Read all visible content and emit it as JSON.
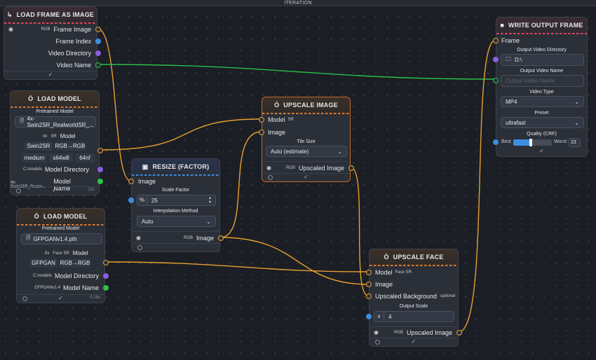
{
  "topbar": {
    "title": "ITERATION"
  },
  "nodes": {
    "load_frame": {
      "title": "LOAD FRAME AS IMAGE",
      "output_frame_image": "Frame Image",
      "output_frame_image_tag": "RGB",
      "output_frame_index": "Frame Index",
      "output_video_directory": "Video Directory",
      "output_video_name": "Video Name"
    },
    "load_model_1": {
      "title": "LOAD MODEL",
      "pretrained_label": "Pretrained Model",
      "pretrained_value": "4x-Swin2SR_RealworldSR_...",
      "scale_tag": "4x",
      "arch_tag": "SR",
      "model_label": "Model",
      "pill_arch": "Swin2SR",
      "pill_color": "RGB→RGB",
      "pill_size": "medium",
      "pill_config": "s64w8",
      "pill_nf": "64nf",
      "dir_tag": "C:\\models",
      "dir_label": "Model Directory",
      "name_tag": "4x-Swin2SR_Realw...",
      "name_label": "Model Name",
      "timer": "12s"
    },
    "load_model_2": {
      "title": "LOAD MODEL",
      "pretrained_label": "Pretrained Model",
      "pretrained_value": "GFPGANv1.4.pth",
      "scale_tag": "8x",
      "arch_tag": "Face SR",
      "model_label": "Model",
      "pill_arch": "GFPGAN",
      "pill_color": "RGB→RGB",
      "dir_tag": "C:\\models",
      "dir_label": "Model Directory",
      "name_tag": "GFPGANv1.4",
      "name_label": "Model Name",
      "timer": "0.18s"
    },
    "resize": {
      "title": "RESIZE (FACTOR)",
      "input_image": "Image",
      "scale_label": "Scale Factor",
      "scale_unit": "%",
      "scale_value": "25",
      "interp_label": "Interpolation Method",
      "interp_value": "Auto",
      "output_tag": "RGB",
      "output_image": "Image"
    },
    "upscale_image": {
      "title": "UPSCALE IMAGE",
      "input_model": "Model",
      "input_model_tag": "SR",
      "input_image": "Image",
      "tile_label": "Tile Size",
      "tile_value": "Auto (estimate)",
      "output_tag": "RGB",
      "output_image": "Upscaled Image"
    },
    "upscale_face": {
      "title": "UPSCALE FACE",
      "input_model": "Model",
      "input_model_tag": "Face SR",
      "input_image": "Image",
      "input_bg": "Upscaled Background",
      "input_bg_tag": "optional",
      "scale_label": "Output Scale",
      "scale_unit": "x",
      "scale_value": "4",
      "output_tag": "RGB",
      "output_image": "Upscaled Image"
    },
    "write_output": {
      "title": "WRITE OUTPUT FRAME",
      "input_frame": "Frame",
      "dir_label": "Output Video Directory",
      "dir_value": "D:\\",
      "name_label": "Output Video Name",
      "name_placeholder": "Output Video Name",
      "type_label": "Video Type",
      "type_value": "MP4",
      "preset_label": "Preset",
      "preset_value": "ultrafast",
      "quality_label": "Quality (CRF)",
      "quality_best": "Best",
      "quality_worst": "Worst",
      "quality_value": "23",
      "quality_fill_fraction": 0.45
    }
  },
  "colors": {
    "wire_image": "#e8a030",
    "wire_string": "#29c04a",
    "port_number": "#3e8ee0",
    "port_directory": "#8a5ee0"
  }
}
